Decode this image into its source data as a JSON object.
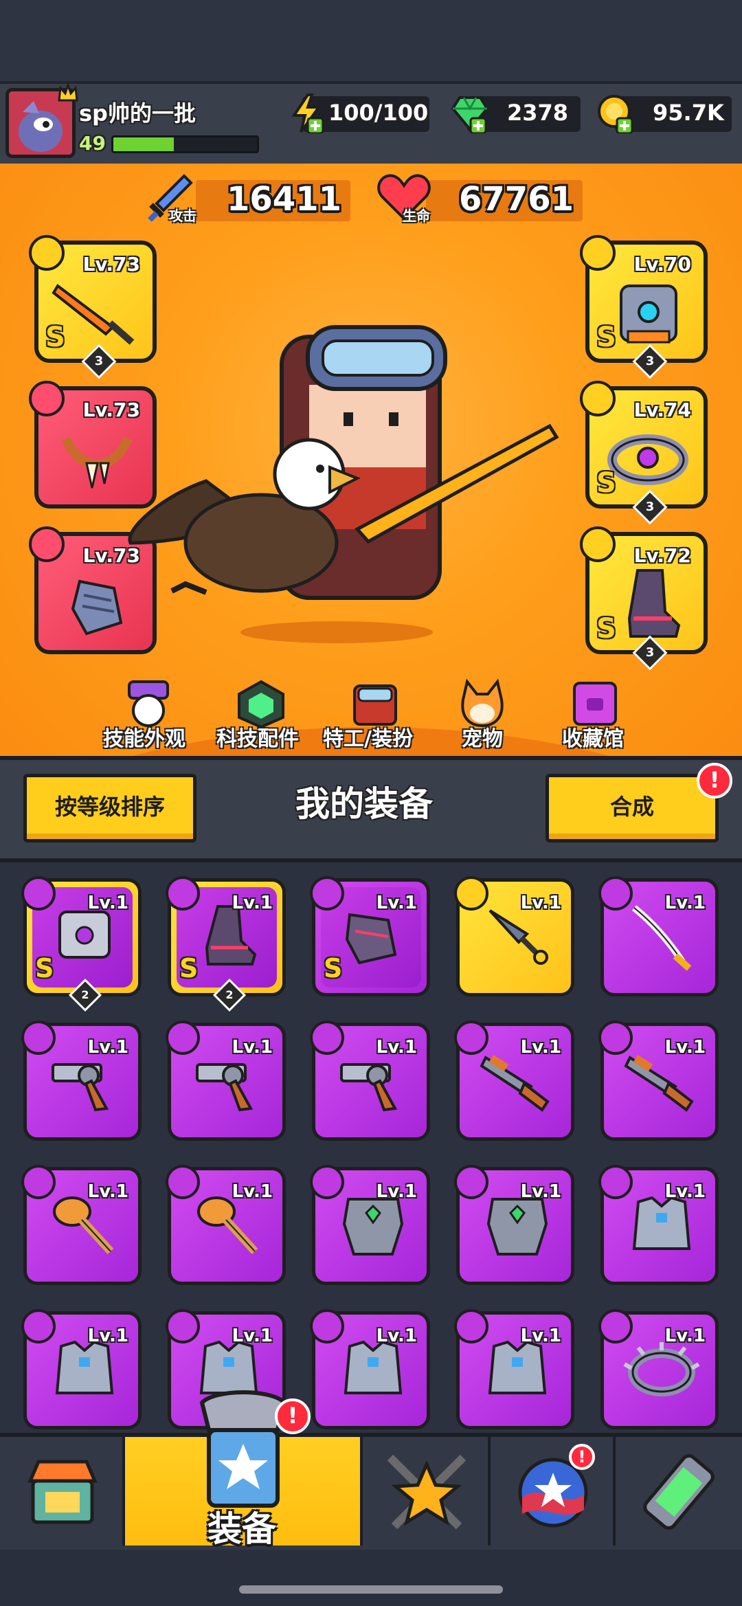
{
  "player": {
    "name": "sp帅的一批",
    "level": "49",
    "xp_fraction": 0.42
  },
  "resources": {
    "energy": "100/100",
    "gems": "2378",
    "gold": "95.7K"
  },
  "stats": {
    "attack_value": "16411",
    "attack_label": "攻击",
    "hp_value": "67761",
    "hp_label": "生命"
  },
  "equipped": [
    {
      "slot": "weapon",
      "level": "Lv.73",
      "grade": "S",
      "stars": "3",
      "color": "yellow"
    },
    {
      "slot": "necklace",
      "level": "Lv.73",
      "grade": "",
      "stars": "",
      "color": "red"
    },
    {
      "slot": "gloves",
      "level": "Lv.73",
      "grade": "",
      "stars": "",
      "color": "red"
    },
    {
      "slot": "armor",
      "level": "Lv.70",
      "grade": "S",
      "stars": "3",
      "color": "yellow"
    },
    {
      "slot": "ring",
      "level": "Lv.74",
      "grade": "S",
      "stars": "3",
      "color": "yellow"
    },
    {
      "slot": "boots",
      "level": "Lv.72",
      "grade": "S",
      "stars": "3",
      "color": "yellow"
    }
  ],
  "categories": [
    "技能外观",
    "科技配件",
    "特工/装扮",
    "宠物",
    "收藏馆"
  ],
  "sort_button": "按等级排序",
  "inventory_title": "我的装备",
  "merge_button": "合成",
  "alert_mark": "!",
  "inventory": [
    {
      "type": "armor",
      "level": "Lv.1",
      "grade": "S",
      "stars": "2",
      "frame": "gold"
    },
    {
      "type": "boots",
      "level": "Lv.1",
      "grade": "S",
      "stars": "2",
      "frame": "gold"
    },
    {
      "type": "gloves",
      "level": "Lv.1",
      "grade": "S",
      "stars": "",
      "frame": "purple"
    },
    {
      "type": "kunai",
      "level": "Lv.1",
      "grade": "",
      "stars": "",
      "frame": "gold"
    },
    {
      "type": "katana",
      "level": "Lv.1",
      "grade": "",
      "stars": "",
      "frame": "purple"
    },
    {
      "type": "revolver",
      "level": "Lv.1",
      "grade": "",
      "stars": "",
      "frame": "purple"
    },
    {
      "type": "revolver",
      "level": "Lv.1",
      "grade": "",
      "stars": "",
      "frame": "purple"
    },
    {
      "type": "revolver",
      "level": "Lv.1",
      "grade": "",
      "stars": "",
      "frame": "purple"
    },
    {
      "type": "shotgun",
      "level": "Lv.1",
      "grade": "",
      "stars": "",
      "frame": "purple"
    },
    {
      "type": "shotgun",
      "level": "Lv.1",
      "grade": "",
      "stars": "",
      "frame": "purple"
    },
    {
      "type": "hammer",
      "level": "Lv.1",
      "grade": "",
      "stars": "",
      "frame": "purple"
    },
    {
      "type": "hammer",
      "level": "Lv.1",
      "grade": "",
      "stars": "",
      "frame": "purple"
    },
    {
      "type": "chest-armor",
      "level": "Lv.1",
      "grade": "",
      "stars": "",
      "frame": "purple"
    },
    {
      "type": "chest-armor",
      "level": "Lv.1",
      "grade": "",
      "stars": "",
      "frame": "purple"
    },
    {
      "type": "vest",
      "level": "Lv.1",
      "grade": "",
      "stars": "",
      "frame": "purple"
    },
    {
      "type": "vest",
      "level": "Lv.1",
      "grade": "",
      "stars": "",
      "frame": "purple"
    },
    {
      "type": "vest",
      "level": "Lv.1",
      "grade": "",
      "stars": "",
      "frame": "purple"
    },
    {
      "type": "vest",
      "level": "Lv.1",
      "grade": "",
      "stars": "",
      "frame": "purple"
    },
    {
      "type": "vest",
      "level": "Lv.1",
      "grade": "",
      "stars": "",
      "frame": "purple"
    },
    {
      "type": "spiked-ring",
      "level": "Lv.1",
      "grade": "",
      "stars": "",
      "frame": "purple"
    }
  ],
  "nav": {
    "equipment_label": "装备"
  },
  "colors": {
    "accent": "#ffcd1c",
    "stage": "#ff9f1c",
    "item_purple": "#b42fe0",
    "slot_red": "#f03f5c",
    "hud": "#3a3f4c"
  }
}
